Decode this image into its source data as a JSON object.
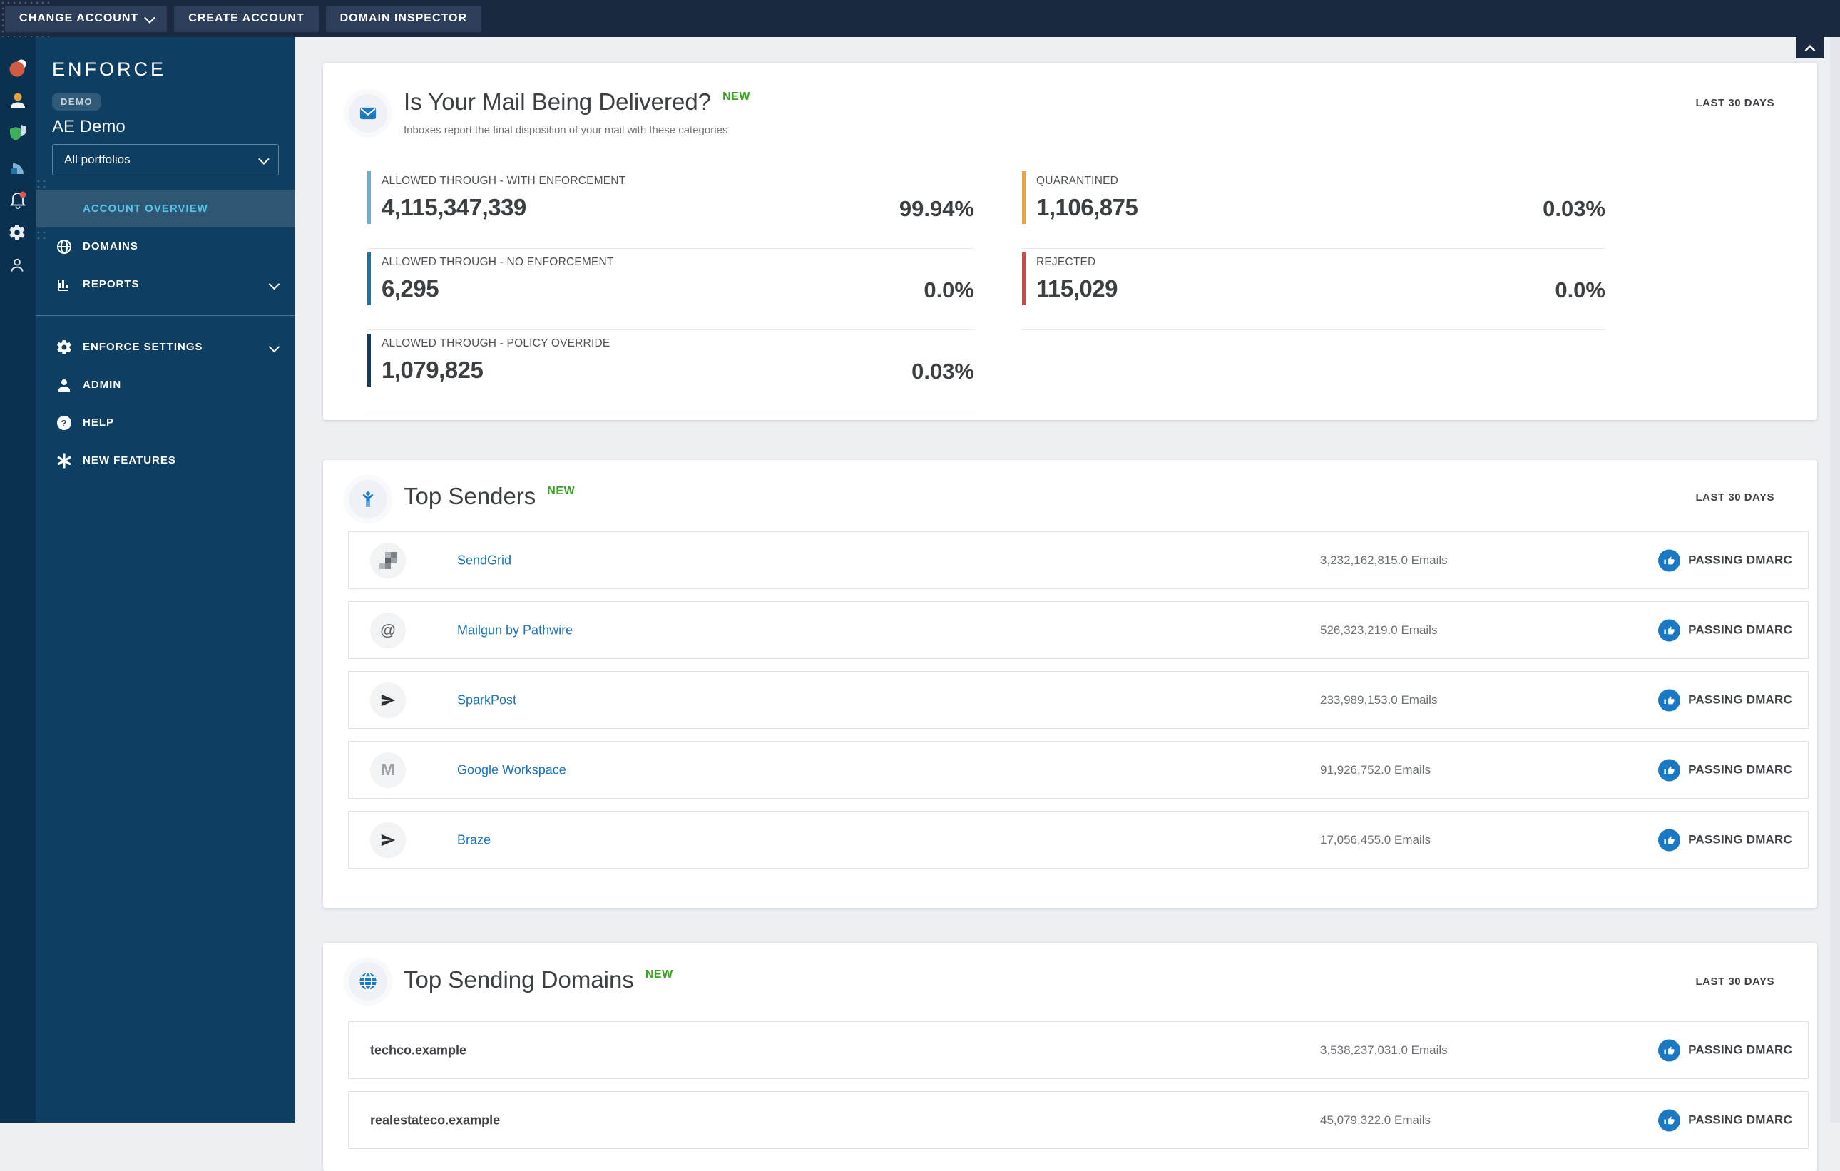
{
  "topbar": {
    "buttons": [
      {
        "label": "CHANGE ACCOUNT",
        "has_chevron": true
      },
      {
        "label": "CREATE ACCOUNT",
        "has_chevron": false
      },
      {
        "label": "DOMAIN INSPECTOR",
        "has_chevron": false
      }
    ]
  },
  "rail": {
    "icons": [
      "valimail-logo",
      "user-amber",
      "shield-green",
      "chart-flag-blue",
      "notifications-bell",
      "settings-gear",
      "profile-outline"
    ]
  },
  "sidebar": {
    "logo": "ENFORCE",
    "badge": "DEMO",
    "account_name": "AE Demo",
    "portfolio_select": {
      "value": "All portfolios"
    },
    "nav": [
      {
        "label": "ACCOUNT OVERVIEW",
        "icon": "grid",
        "active": true
      },
      {
        "label": "DOMAINS",
        "icon": "globe"
      },
      {
        "label": "REPORTS",
        "icon": "bar-chart",
        "expandable": true
      },
      {
        "label": "ENFORCE SETTINGS",
        "icon": "gear",
        "expandable": true
      },
      {
        "label": "ADMIN",
        "icon": "person"
      },
      {
        "label": "HELP",
        "icon": "help"
      },
      {
        "label": "NEW FEATURES",
        "icon": "asterisk"
      }
    ]
  },
  "cards": {
    "delivery": {
      "title": "Is Your Mail Being Delivered?",
      "badge": "NEW",
      "subtitle": "Inboxes report the final disposition of your mail with these categories",
      "period": "LAST 30 DAYS",
      "stats": [
        {
          "label": "ALLOWED THROUGH - WITH ENFORCEMENT",
          "value": "4,115,347,339",
          "percent": "99.94%",
          "color": "#68aed6",
          "column": "left"
        },
        {
          "label": "ALLOWED THROUGH - NO ENFORCEMENT",
          "value": "6,295",
          "percent": "0.0%",
          "color": "#1874ad",
          "column": "left"
        },
        {
          "label": "ALLOWED THROUGH - POLICY OVERRIDE",
          "value": "1,079,825",
          "percent": "0.03%",
          "color": "#0e3d5f",
          "column": "left"
        },
        {
          "label": "QUARANTINED",
          "value": "1,106,875",
          "percent": "0.03%",
          "color": "#f0a22e",
          "column": "right"
        },
        {
          "label": "REJECTED",
          "value": "115,029",
          "percent": "0.0%",
          "color": "#d24840",
          "column": "right"
        }
      ]
    },
    "top_senders": {
      "title": "Top Senders",
      "badge": "NEW",
      "period": "LAST 30 DAYS",
      "rows": [
        {
          "name": "SendGrid",
          "emails": "3,232,162,815.0 Emails",
          "status": "PASSING DMARC",
          "icon": "sendgrid-pixel-logo"
        },
        {
          "name": "Mailgun by Pathwire",
          "emails": "526,323,219.0 Emails",
          "status": "PASSING DMARC",
          "icon": "mailgun-at-logo"
        },
        {
          "name": "SparkPost",
          "emails": "233,989,153.0 Emails",
          "status": "PASSING DMARC",
          "icon": "paper-plane-logo"
        },
        {
          "name": "Google Workspace",
          "emails": "91,926,752.0 Emails",
          "status": "PASSING DMARC",
          "icon": "google-m-logo"
        },
        {
          "name": "Braze",
          "emails": "17,056,455.0 Emails",
          "status": "PASSING DMARC",
          "icon": "paper-plane-logo"
        }
      ]
    },
    "top_domains": {
      "title": "Top Sending Domains",
      "badge": "NEW",
      "period": "LAST 30 DAYS",
      "rows": [
        {
          "name": "techco.example",
          "emails": "3,538,237,031.0 Emails",
          "status": "PASSING DMARC"
        },
        {
          "name": "realestateco.example",
          "emails": "45,079,322.0 Emails",
          "status": "PASSING DMARC"
        }
      ]
    }
  },
  "colors": {
    "topbar": "#1b2940",
    "rail": "#0a3150",
    "sidebar": "#0e3e61",
    "active_nav_bg": "#2f5673",
    "active_nav_text": "#55c3ea",
    "link_blue": "#1b73b9",
    "passing_blue": "#1b78c3",
    "new_green": "#38a420"
  }
}
